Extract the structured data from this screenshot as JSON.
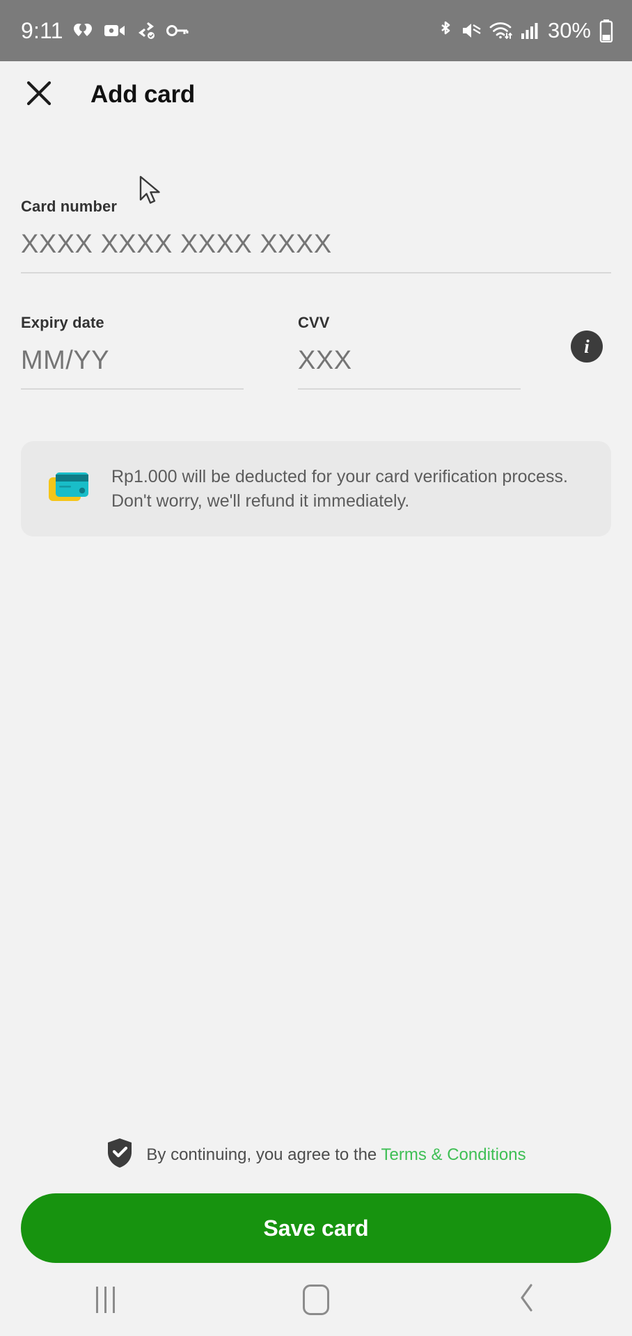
{
  "statusbar": {
    "time": "9:11",
    "battery_percent": "30%",
    "left_icons": [
      "heart-rate-icon",
      "video-camera-icon",
      "data-transfer-icon",
      "vpn-key-icon"
    ],
    "right_icons": [
      "bluetooth-icon",
      "volume-mute-icon",
      "wifi-icon",
      "cellular-signal-icon",
      "battery-icon"
    ]
  },
  "header": {
    "close_icon": "close-icon",
    "title": "Add card"
  },
  "form": {
    "card_number": {
      "label": "Card number",
      "placeholder": "XXXX XXXX XXXX XXXX",
      "value": ""
    },
    "expiry": {
      "label": "Expiry date",
      "placeholder": "MM/YY",
      "value": ""
    },
    "cvv": {
      "label": "CVV",
      "placeholder": "XXX",
      "value": "",
      "info_icon": "info-icon",
      "info_glyph": "i"
    }
  },
  "notice": {
    "icon": "credit-cards-icon",
    "text": "Rp1.000 will be deducted for your card verification process. Don't worry, we'll refund it immediately."
  },
  "footer": {
    "shield_icon": "shield-check-icon",
    "terms_prefix": "By continuing, you agree to the ",
    "terms_link": "Terms & Conditions",
    "save_label": "Save card"
  },
  "navbar": {
    "recents_icon": "recents-icon",
    "home_icon": "home-icon",
    "back_icon": "back-chevron-icon"
  },
  "colors": {
    "brand_green": "#17930f",
    "link_green": "#3fbf55",
    "statusbar_bg": "#7b7b7b",
    "page_bg": "#f2f2f2",
    "notice_bg": "#e9e9e9"
  }
}
